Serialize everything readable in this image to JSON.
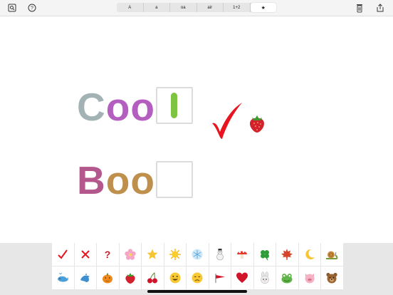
{
  "toolbar": {
    "segments": [
      "A",
      "a",
      "oa",
      "air",
      "1+2",
      "★"
    ],
    "selected_index": 5
  },
  "words": [
    {
      "letters": [
        "C",
        "o",
        "o"
      ],
      "letter_colors": [
        "#a3b2b5",
        "#b45ec0",
        "#b45ec0"
      ],
      "slot_filled": true,
      "slot_letter_color": "#7dc443",
      "result_mark": "check-mark",
      "reward": "strawberry"
    },
    {
      "letters": [
        "B",
        "o",
        "o"
      ],
      "letter_colors": [
        "#b4578c",
        "#bf8f4c",
        "#bf8f4c"
      ],
      "slot_filled": false
    }
  ],
  "stickers": {
    "row1": [
      "check-mark",
      "cross-mark",
      "question-mark",
      "cherry-blossom",
      "star",
      "sun",
      "snowflake",
      "snowman",
      "mushroom",
      "four-leaf-clover",
      "maple-leaf",
      "crescent-moon",
      "snail"
    ],
    "row2": [
      "whale",
      "dolphin",
      "jack-o-lantern",
      "strawberry",
      "cherries",
      "smiling-face",
      "disappointed-face",
      "triangular-flag",
      "red-heart",
      "rabbit-face",
      "frog-face",
      "pig-face",
      "bear-face"
    ]
  },
  "colors": {
    "check_red": "#e8141f",
    "slot_border": "#dcdcdc",
    "tray_bg": "#e7e7e7"
  }
}
